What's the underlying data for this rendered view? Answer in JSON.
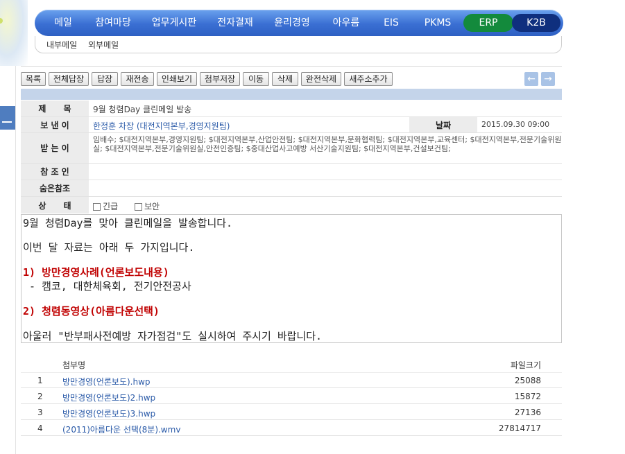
{
  "nav": {
    "items": [
      "메일",
      "참여마당",
      "업무게시판",
      "전자결재",
      "윤리경영",
      "아우름",
      "EIS",
      "PKMS"
    ],
    "erp": "ERP",
    "k2b": "K2B"
  },
  "subnav": {
    "internal": "내부메일",
    "external": "외부메일"
  },
  "toolbar": {
    "buttons": [
      "목록",
      "전체답장",
      "답장",
      "재전송",
      "인쇄보기",
      "첨부저장",
      "이동",
      "삭제",
      "완전삭제",
      "새주소추가"
    ],
    "prev_icon": "arrow-left-icon",
    "next_icon": "arrow-right-icon"
  },
  "header": {
    "subject_label": "제      목",
    "subject": "9월 청렴Day 클린메일 발송",
    "sender_label": "보 낸 이",
    "sender": "한정훈 차장 (대전지역본부,경영지원팀)",
    "date_label": "날짜",
    "date": "2015.09.30 09:00",
    "recipients_label": "받 는 이",
    "recipients": "임배수; $대전지역본부,경영지원팀; $대전지역본부,산업안전팀; $대전지역본부,문화협력팀; $대전지역본부,교육센터; $대전지역본부,전문기술위원실; $대전지역본부,전문기술위원실,안전인증팀; $중대산업사고예방 서산기술지원팀; $대전지역본부,건설보건팀;",
    "cc_label": "참 조 인",
    "bcc_label": "숨은참조",
    "status_label": "상      태",
    "urgent": "긴급",
    "secure": "보안"
  },
  "body": {
    "line1": "9월 청렴Day를 맞아 클린메일을 발송합니다.",
    "line2": "이번 달 자료는 아래 두 가지입니다.",
    "item1": "1) 방만경영사례(언론보도내용)",
    "item1_sub": " - 캠코, 대한체육회, 전기안전공사",
    "item2": "2) 청렴동영상(아름다운선택)",
    "closing": "아울러 \"반부패사전예방 자가점검\"도 실시하여 주시기 바랍니다."
  },
  "attachments": {
    "name_header": "첨부명",
    "size_header": "파일크기",
    "files": [
      {
        "no": "1",
        "name": "방만경영(언론보도).hwp",
        "size": "25088"
      },
      {
        "no": "2",
        "name": "방만경영(언론보도)2.hwp",
        "size": "15872"
      },
      {
        "no": "3",
        "name": "방만경영(언론보도)3.hwp",
        "size": "27136"
      },
      {
        "no": "4",
        "name": "(2011)아름다운 선택(8분).wmv",
        "size": "27814717"
      }
    ]
  }
}
